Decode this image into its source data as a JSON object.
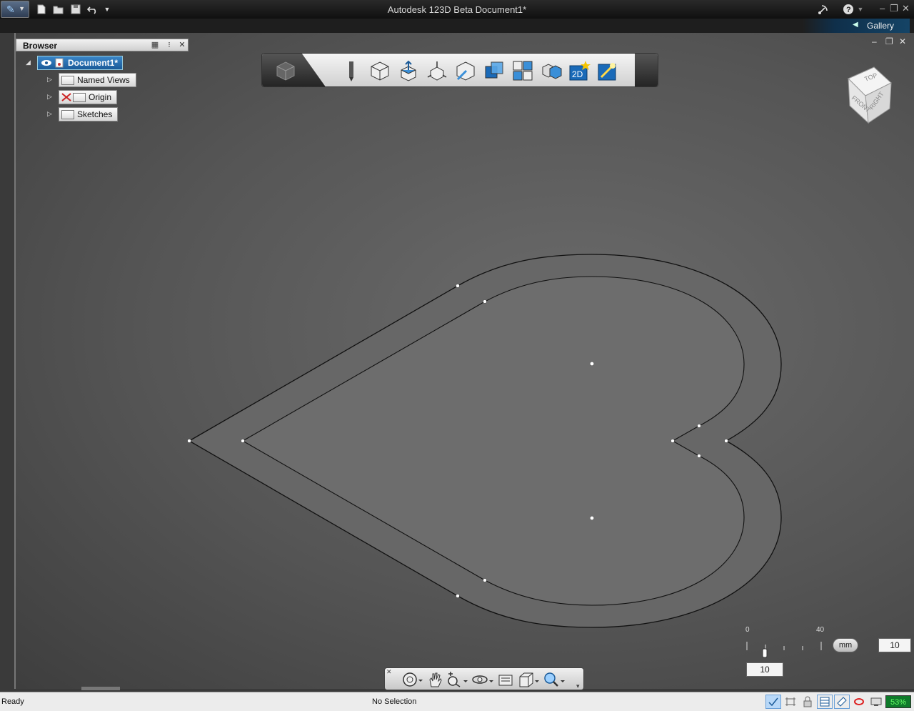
{
  "app": {
    "title": "Autodesk 123D Beta   Document1*",
    "gallery_label": "Gallery"
  },
  "browser": {
    "header": "Browser",
    "document_label": "Document1*",
    "nodes": [
      {
        "label": "Named Views"
      },
      {
        "label": "Origin"
      },
      {
        "label": "Sketches"
      }
    ]
  },
  "scale": {
    "tick_start": "0",
    "tick_end": "40",
    "unit_label": "mm",
    "value_right": "10",
    "value_below": "10"
  },
  "status": {
    "left": "Ready",
    "selection": "No Selection",
    "percent": "53%"
  },
  "icons": {
    "app_menu": "app-menu-icon",
    "new": "new-file-icon",
    "open": "open-file-icon",
    "save": "save-icon",
    "undo": "undo-icon",
    "help": "help-icon"
  },
  "colors": {
    "canvas_center": "#6b6b6b",
    "canvas_edge": "#3e3e3e",
    "selection_blue": "#1a5a98",
    "status_green": "#0f7a2a"
  }
}
